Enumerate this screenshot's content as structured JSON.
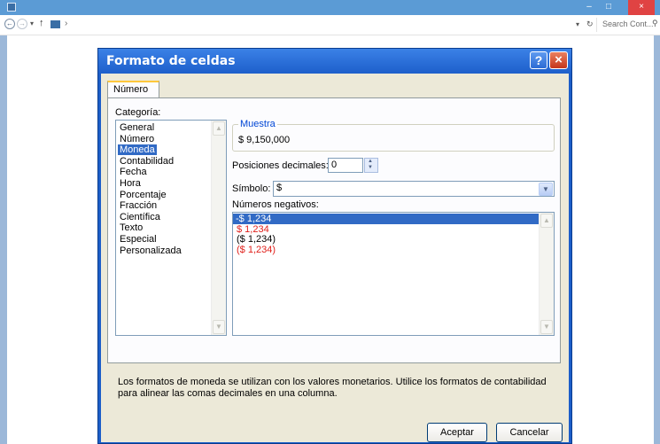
{
  "explorer": {
    "minimize": "–",
    "maximize": "□",
    "close": "×",
    "search_placeholder": "Search Cont..."
  },
  "dialog": {
    "title": "Formato de celdas",
    "help": "?",
    "close": "×",
    "tab_label": "Número",
    "category_label": "Categoría:",
    "categories": [
      "General",
      "Número",
      "Moneda",
      "Contabilidad",
      "Fecha",
      "Hora",
      "Porcentaje",
      "Fracción",
      "Científica",
      "Texto",
      "Especial",
      "Personalizada"
    ],
    "selected_category": "Moneda",
    "sample": {
      "legend": "Muestra",
      "value": "$ 9,150,000"
    },
    "decimals": {
      "label": "Posiciones decimales:",
      "value": "0"
    },
    "symbol": {
      "label": "Símbolo:",
      "value": "$"
    },
    "negatives": {
      "label": "Números negativos:",
      "items": [
        {
          "text": "-$ 1,234",
          "color": "#ffffff",
          "selected": true
        },
        {
          "text": "$ 1,234",
          "color": "#e0201b",
          "selected": false
        },
        {
          "text": "($ 1,234)",
          "color": "#000000",
          "selected": false
        },
        {
          "text": "($ 1,234)",
          "color": "#e0201b",
          "selected": false
        }
      ]
    },
    "description": "Los formatos de moneda se utilizan con los valores monetarios. Utilice los formatos de contabilidad para alinear las comas decimales en una columna.",
    "ok_button": "Aceptar",
    "cancel_button": "Cancelar"
  }
}
